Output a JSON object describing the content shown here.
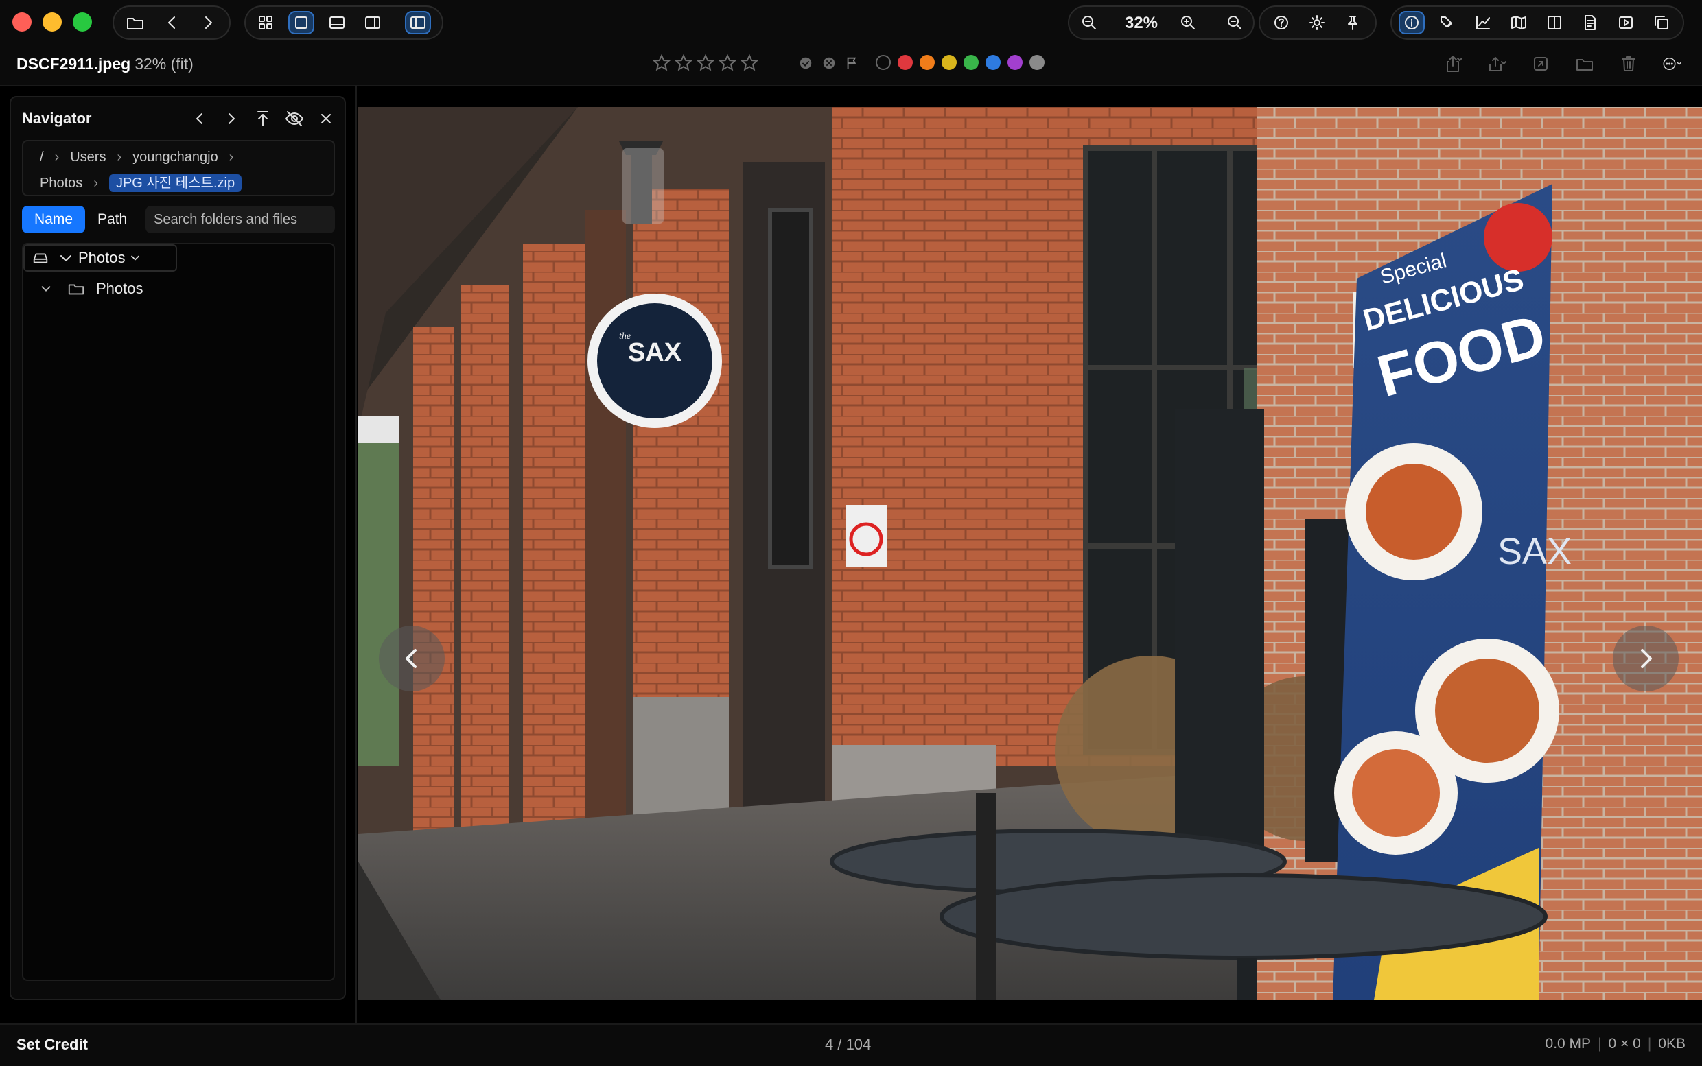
{
  "toolbar": {
    "zoom_label": "32%",
    "view_modes": [
      "grid-icon",
      "single-view-icon",
      "filmstrip-icon",
      "sidebar-right-icon",
      "sidebar-left-icon"
    ],
    "right_tools": [
      "info-icon",
      "tags-icon",
      "chart-icon",
      "map-icon",
      "split-view-icon",
      "document-icon",
      "slideshow-icon",
      "copy-icon"
    ]
  },
  "subbar": {
    "filename": "DSCF2911.jpeg",
    "zoom_info": "32% (fit)",
    "rating_max": 5,
    "color_labels": [
      "#e0383e",
      "#f07d1a",
      "#d9b51c",
      "#39b54a",
      "#2e7be0",
      "#a23fcf",
      "#8a8a8a"
    ]
  },
  "navigator": {
    "title": "Navigator",
    "breadcrumb": {
      "root": "/",
      "users": "Users",
      "user": "youngchangjo",
      "photos": "Photos",
      "selected": "JPG 사진 테스트.zip"
    },
    "tabs": {
      "name": "Name",
      "path": "Path"
    },
    "search_placeholder": "Search folders and files",
    "root_label": "Photos",
    "tree_item": "Photos"
  },
  "viewer": {
    "sign_sax": "SAX",
    "sign_the": "the",
    "poster": {
      "special": "Special",
      "delicious": "DELICIOUS",
      "food": "FOOD",
      "sax": "SAX"
    }
  },
  "statusbar": {
    "set_credit": "Set Credit",
    "counter": "4 / 104",
    "megapixels": "0.0 MP",
    "dimensions": "0 × 0",
    "size": "0KB"
  }
}
